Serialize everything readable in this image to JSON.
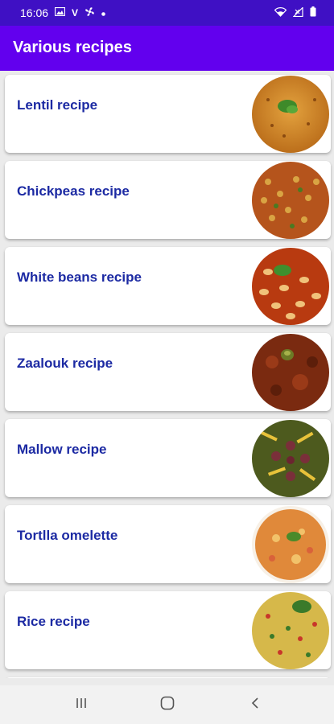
{
  "status_bar": {
    "time": "16:06",
    "left_icons": [
      "image-icon",
      "v-icon",
      "fan-icon",
      "dot-icon"
    ],
    "right_icons": [
      "wifi-icon",
      "signal-icon",
      "battery-icon"
    ],
    "colors": {
      "background": "#3f10c4",
      "foreground": "#ffffff"
    }
  },
  "app_bar": {
    "title": "Various recipes",
    "colors": {
      "background": "#6200ee",
      "foreground": "#ffffff"
    }
  },
  "recipes": [
    {
      "title": "Lentil recipe",
      "image": "lentil-dish-photo"
    },
    {
      "title": "Chickpeas recipe",
      "image": "chickpeas-dish-photo"
    },
    {
      "title": "White beans recipe",
      "image": "white-beans-dish-photo"
    },
    {
      "title": "Zaalouk recipe",
      "image": "zaalouk-dish-photo"
    },
    {
      "title": "Mallow recipe",
      "image": "mallow-dish-photo"
    },
    {
      "title": "Tortlla omelette",
      "image": "tortilla-omelette-photo"
    },
    {
      "title": "Rice recipe",
      "image": "rice-dish-photo"
    }
  ],
  "nav_bar": {
    "buttons": [
      "recent-apps-icon",
      "home-icon",
      "back-icon"
    ]
  },
  "colors": {
    "card_title": "#1c2aa3",
    "list_background": "#ebebeb"
  }
}
